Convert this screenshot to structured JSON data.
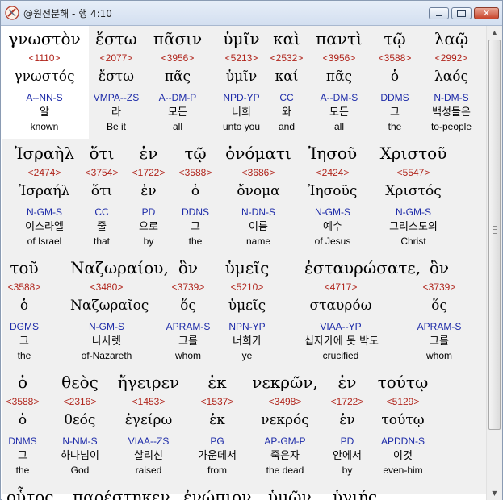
{
  "window": {
    "title": "@원전분해 - 행 4:10"
  },
  "rows": [
    {
      "words": [
        {
          "greek": "γνωστὸν",
          "strong": "<1110>",
          "lemma": "γνωστός",
          "morph": "A--NN-S",
          "korean": "알",
          "english": "known"
        },
        {
          "greek": "ἔστω",
          "strong": "<2077>",
          "lemma": "ἔστω",
          "morph": "VMPA--ZS",
          "korean": "라",
          "english": "Be it"
        },
        {
          "greek": "πᾶσιν",
          "strong": "<3956>",
          "lemma": "πᾶς",
          "morph": "A--DM-P",
          "korean": "모든",
          "english": "all"
        },
        {
          "greek": "ὑμῖν",
          "strong": "<5213>",
          "lemma": "ὑμῖν",
          "morph": "NPD-YP",
          "korean": "너희",
          "english": "unto you"
        },
        {
          "greek": "καὶ",
          "strong": "<2532>",
          "lemma": "καί",
          "morph": "CC",
          "korean": "와",
          "english": "and"
        },
        {
          "greek": "παντὶ",
          "strong": "<3956>",
          "lemma": "πᾶς",
          "morph": "A--DM-S",
          "korean": "모든",
          "english": "all"
        },
        {
          "greek": "τῷ",
          "strong": "<3588>",
          "lemma": "ὁ",
          "morph": "DDMS",
          "korean": "그",
          "english": "the"
        },
        {
          "greek": "λαῷ",
          "strong": "<2992>",
          "lemma": "λαός",
          "morph": "N-DM-S",
          "korean": "백성들은",
          "english": "to-people"
        }
      ]
    },
    {
      "words": [
        {
          "greek": "Ἰσραὴλ",
          "strong": "<2474>",
          "lemma": "Ἰσραήλ",
          "morph": "N-GM-S",
          "korean": "이스라엘",
          "english": "of Israel"
        },
        {
          "greek": "ὅτι",
          "strong": "<3754>",
          "lemma": "ὅτι",
          "morph": "CC",
          "korean": "줄",
          "english": "that"
        },
        {
          "greek": "ἐν",
          "strong": "<1722>",
          "lemma": "ἐν",
          "morph": "PD",
          "korean": "으로",
          "english": "by"
        },
        {
          "greek": "τῷ",
          "strong": "<3588>",
          "lemma": "ὁ",
          "morph": "DDNS",
          "korean": "그",
          "english": "the"
        },
        {
          "greek": "ὀνόματι",
          "strong": "<3686>",
          "lemma": "ὄνομα",
          "morph": "N-DN-S",
          "korean": "이름",
          "english": "name"
        },
        {
          "greek": "Ἰησοῦ",
          "strong": "<2424>",
          "lemma": "Ἰησοῦς",
          "morph": "N-GM-S",
          "korean": "예수",
          "english": "of Jesus"
        },
        {
          "greek": "Χριστοῦ",
          "strong": "<5547>",
          "lemma": "Χριστός",
          "morph": "N-GM-S",
          "korean": "그리스도의",
          "english": "Christ"
        }
      ]
    },
    {
      "words": [
        {
          "greek": "τοῦ",
          "strong": "<3588>",
          "lemma": "ὁ",
          "morph": "DGMS",
          "korean": "그",
          "english": "the"
        },
        {
          "greek": "Ναζωραίου,",
          "strong": "<3480>",
          "lemma": "Ναζωραῖος",
          "morph": "N-GM-S",
          "korean": "나사렛",
          "english": "of-Nazareth"
        },
        {
          "greek": "ὃν",
          "strong": "<3739>",
          "lemma": "ὅς",
          "morph": "APRAM-S",
          "korean": "그를",
          "english": "whom"
        },
        {
          "greek": "ὑμεῖς",
          "strong": "<5210>",
          "lemma": "ὑμεῖς",
          "morph": "NPN-YP",
          "korean": "너희가",
          "english": "ye"
        },
        {
          "greek": "ἐσταυρώσατε,",
          "strong": "<4717>",
          "lemma": "σταυρόω",
          "morph": "VIAA--YP",
          "korean": "십자가에 못 박도",
          "english": "crucified"
        },
        {
          "greek": "ὃν",
          "strong": "<3739>",
          "lemma": "ὅς",
          "morph": "APRAM-S",
          "korean": "그를",
          "english": "whom"
        }
      ]
    },
    {
      "words": [
        {
          "greek": "ὁ",
          "strong": "<3588>",
          "lemma": "ὁ",
          "morph": "DNMS",
          "korean": "그",
          "english": "the"
        },
        {
          "greek": "θεὸς",
          "strong": "<2316>",
          "lemma": "θεός",
          "morph": "N-NM-S",
          "korean": "하나님이",
          "english": "God"
        },
        {
          "greek": "ἤγειρεν",
          "strong": "<1453>",
          "lemma": "ἐγείρω",
          "morph": "VIAA--ZS",
          "korean": "살리신",
          "english": "raised"
        },
        {
          "greek": "ἐκ",
          "strong": "<1537>",
          "lemma": "ἐκ",
          "morph": "PG",
          "korean": "가운데서",
          "english": "from"
        },
        {
          "greek": "νεκρῶν,",
          "strong": "<3498>",
          "lemma": "νεκρός",
          "morph": "AP-GM-P",
          "korean": "죽은자",
          "english": "the dead"
        },
        {
          "greek": "ἐν",
          "strong": "<1722>",
          "lemma": "ἐν",
          "morph": "PD",
          "korean": "안에서",
          "english": "by"
        },
        {
          "greek": "τούτῳ",
          "strong": "<5129>",
          "lemma": "τούτῳ",
          "morph": "APDDN-S",
          "korean": "이것",
          "english": "even-him"
        }
      ]
    }
  ],
  "partial_row": [
    "οὗτος",
    "παρέστηκεν",
    "ἐνώπιον",
    "ὑμῶν",
    "ὑγιής."
  ],
  "colors": {
    "strong": "#b0241b",
    "morph": "#1c2aa8",
    "background": "#f0f0f0"
  }
}
